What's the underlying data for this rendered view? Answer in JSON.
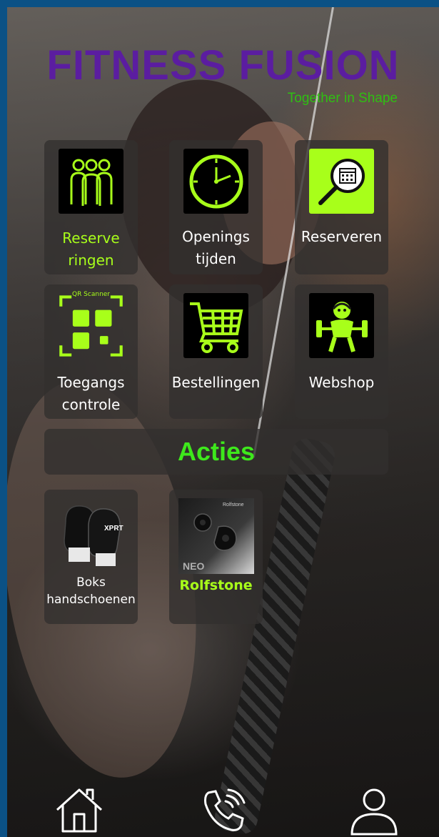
{
  "app": {
    "title": "FITNESS FUSION",
    "tagline": "Together in Shape"
  },
  "colors": {
    "logo": "#5b1da0",
    "tagline": "#2fbf12",
    "accent": "#a8ff1a",
    "acties": "#3ee81c"
  },
  "tiles": [
    {
      "label_1": "Reserve",
      "label_2": "ringen",
      "icon": "group-icon"
    },
    {
      "label_1": "Openings",
      "label_2": "tijden",
      "icon": "clock-icon"
    },
    {
      "label_1": "Reserveren",
      "icon": "calendar-search-icon"
    },
    {
      "label_1": "Toegangs",
      "label_2": "controle",
      "icon": "qr-scanner-icon",
      "icon_caption": "QR Scanner"
    },
    {
      "label_1": "Bestellingen",
      "icon": "shopping-cart-icon"
    },
    {
      "label_1": "Webshop",
      "icon": "weightlifter-icon"
    }
  ],
  "section": {
    "title": "Acties"
  },
  "products": [
    {
      "label_1": "Boks",
      "label_2": "handschoenen",
      "image": "boxing-gloves-image",
      "brand_text": "XPRT"
    },
    {
      "label_1": "Rolfstone",
      "image": "earbuds-image",
      "brand_text": "Rolfstone",
      "model_text": "NEO"
    }
  ],
  "nav": [
    {
      "icon": "home-icon"
    },
    {
      "icon": "phone-icon"
    },
    {
      "icon": "user-icon"
    }
  ]
}
